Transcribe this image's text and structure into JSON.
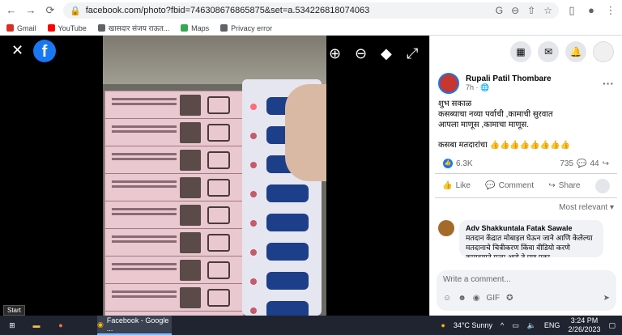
{
  "browser": {
    "url": "facebook.com/photo?fbid=746308676865875&set=a.534226818074063",
    "nav": {
      "back": "←",
      "forward": "→",
      "reload": "⟳"
    }
  },
  "bookmarks": [
    {
      "label": "Gmail",
      "color": "#d93025"
    },
    {
      "label": "YouTube",
      "color": "#ff0000"
    },
    {
      "label": "खासदार संजय राऊत...",
      "color": "#3c4043"
    },
    {
      "label": "Maps",
      "color": "#34a853"
    },
    {
      "label": "Privacy error",
      "color": "#3c4043"
    }
  ],
  "panel": {
    "author": "Rupali Patil Thombare",
    "time": "7h ·",
    "post_lines": [
      "शुभ सकाळ",
      "कसब्याचा नव्या पर्वाची ,कामाची सुरवात",
      "आपला माणूस ,कामाचा माणूस."
    ],
    "post_tag": "कसबा मतदारांचा 👍👍👍👍👍👍👍👍",
    "reactions": "6.3K",
    "comments_count": "735",
    "shares_count": "44",
    "actions": {
      "like": "Like",
      "comment": "Comment",
      "share": "Share"
    },
    "sort": "Most relevant ▾",
    "comment": {
      "name": "Adv Shakkuntala Fatak Sawale",
      "text": "मतदान केंद्रात मोबाइल घेऊन जाने आणि केलेल्या मतदानाचे चित्रीकरण किंवा वीडियो करणे कायदयाने गुन्हा आहे,ते पण एका"
    },
    "write_placeholder": "Write a comment..."
  },
  "taskbar": {
    "start_tip": "Start",
    "active_app": "Facebook - Google ...",
    "weather": "34°C  Sunny",
    "lang": "ENG",
    "time": "3:24 PM",
    "date": "2/26/2023"
  }
}
